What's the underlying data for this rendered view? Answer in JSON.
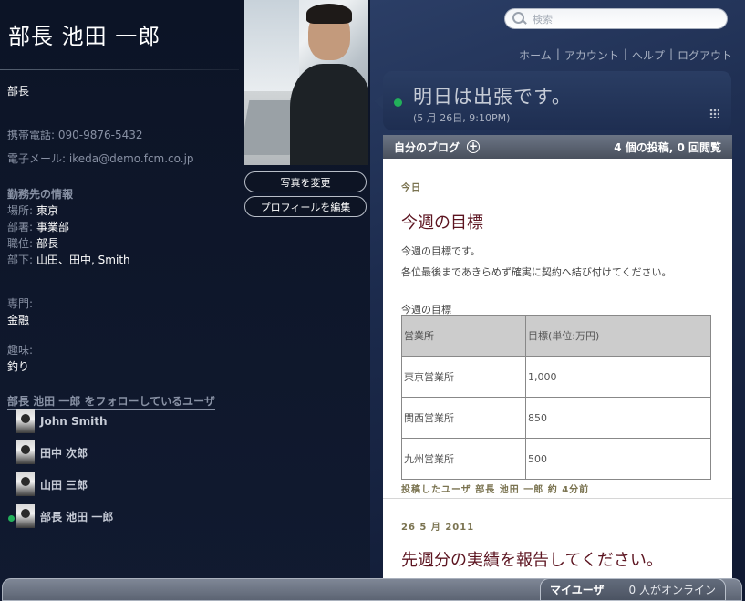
{
  "profile": {
    "name": "部長 池田 一郎",
    "title": "部長",
    "mobile": {
      "label": "携帯電話:",
      "value": "090-9876-5432"
    },
    "email": {
      "label": "電子メール:",
      "value": "ikeda@demo.fcm.co.jp"
    },
    "work_section": "勤務先の情報",
    "work": [
      {
        "label": "場所:",
        "value": "東京"
      },
      {
        "label": "部署:",
        "value": "事業部"
      },
      {
        "label": "職位:",
        "value": "部長"
      },
      {
        "label": "部下:",
        "value": "山田、田中, Smith"
      }
    ],
    "specialty": {
      "label": "専門:",
      "value": "金融"
    },
    "hobby": {
      "label": "趣味:",
      "value": "釣り"
    }
  },
  "photo_buttons": {
    "change_photo": "写真を変更",
    "edit_profile": "プロフィールを編集"
  },
  "followers": {
    "heading": "部長 池田 一郎 をフォローしているユーザ",
    "items": [
      {
        "name": "John Smith",
        "online": false
      },
      {
        "name": "田中 次郎",
        "online": false
      },
      {
        "name": "山田 三郎",
        "online": false
      },
      {
        "name": "部長 池田 一郎",
        "online": true
      }
    ]
  },
  "search": {
    "placeholder": "検索"
  },
  "topnav": [
    "ホーム",
    "アカウント",
    "ヘルプ",
    "ログアウト"
  ],
  "status": {
    "message": "明日は出張です。",
    "time": "(5 月 26日, 9:10PM)"
  },
  "blog": {
    "title": "自分のブログ",
    "stats": "4 個の投稿, 0 回閲覧",
    "post1": {
      "date": "今日",
      "title": "今週の目標",
      "lines": [
        "今週の目標です。",
        "各位最後まであきらめず確実に契約へ結び付けてください。"
      ],
      "table_caption": "今週の目標",
      "table_headers": [
        "営業所",
        "目標(単位:万円)"
      ],
      "table_rows": [
        [
          "東京営業所",
          "1,000"
        ],
        [
          "関西営業所",
          "850"
        ],
        [
          "九州営業所",
          "500"
        ]
      ],
      "byline": "投稿したユーザ 部長 池田 一郎 約 4分前"
    },
    "post2": {
      "date": "26 5 月 2011",
      "title": "先週分の実績を報告してください。"
    }
  },
  "bottom": {
    "my_users": "マイユーザ",
    "online_count": "0 人がオンライン"
  },
  "colors": {
    "online": "#22b05a",
    "post_title": "#5c1420",
    "background": "#0d1424"
  }
}
